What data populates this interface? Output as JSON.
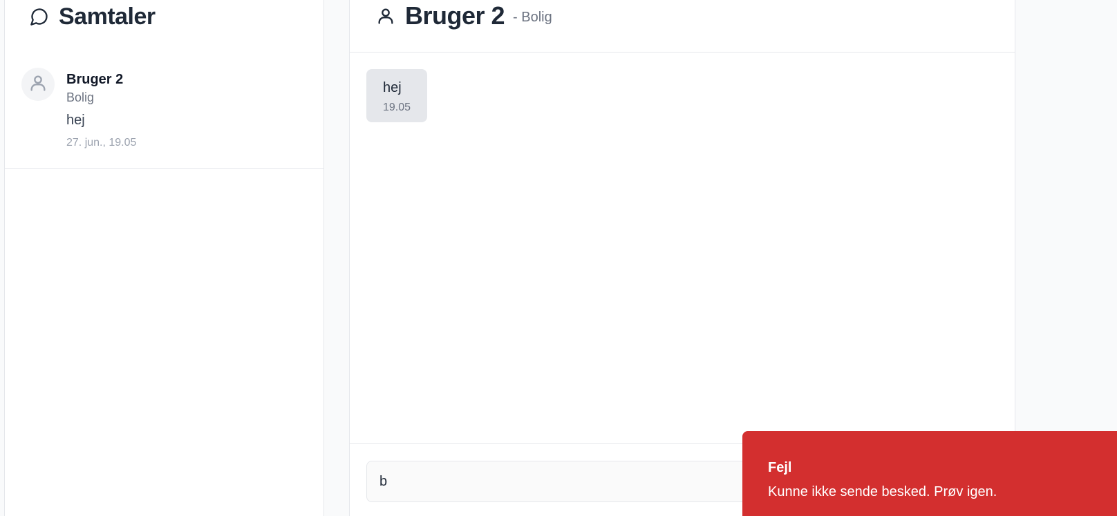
{
  "sidebar": {
    "title": "Samtaler",
    "icon": "chat-bubble-icon",
    "conversations": [
      {
        "name": "Bruger 2",
        "category": "Bolig",
        "preview": "hej",
        "time": "27. jun., 19.05",
        "avatar_icon": "user-icon"
      }
    ]
  },
  "chat": {
    "title": "Bruger 2",
    "subtitle": "- Bolig",
    "icon": "user-icon",
    "messages": [
      {
        "text": "hej",
        "time": "19.05"
      }
    ],
    "input_value": "b"
  },
  "toast": {
    "title": "Fejl",
    "message": "Kunne ikke sende besked. Prøv igen.",
    "color": "#d32f2f"
  },
  "colors": {
    "background": "#f9fafb",
    "panel": "#ffffff",
    "border": "#e5e7eb",
    "bubble": "#e5e7eb",
    "error": "#d32f2f"
  }
}
